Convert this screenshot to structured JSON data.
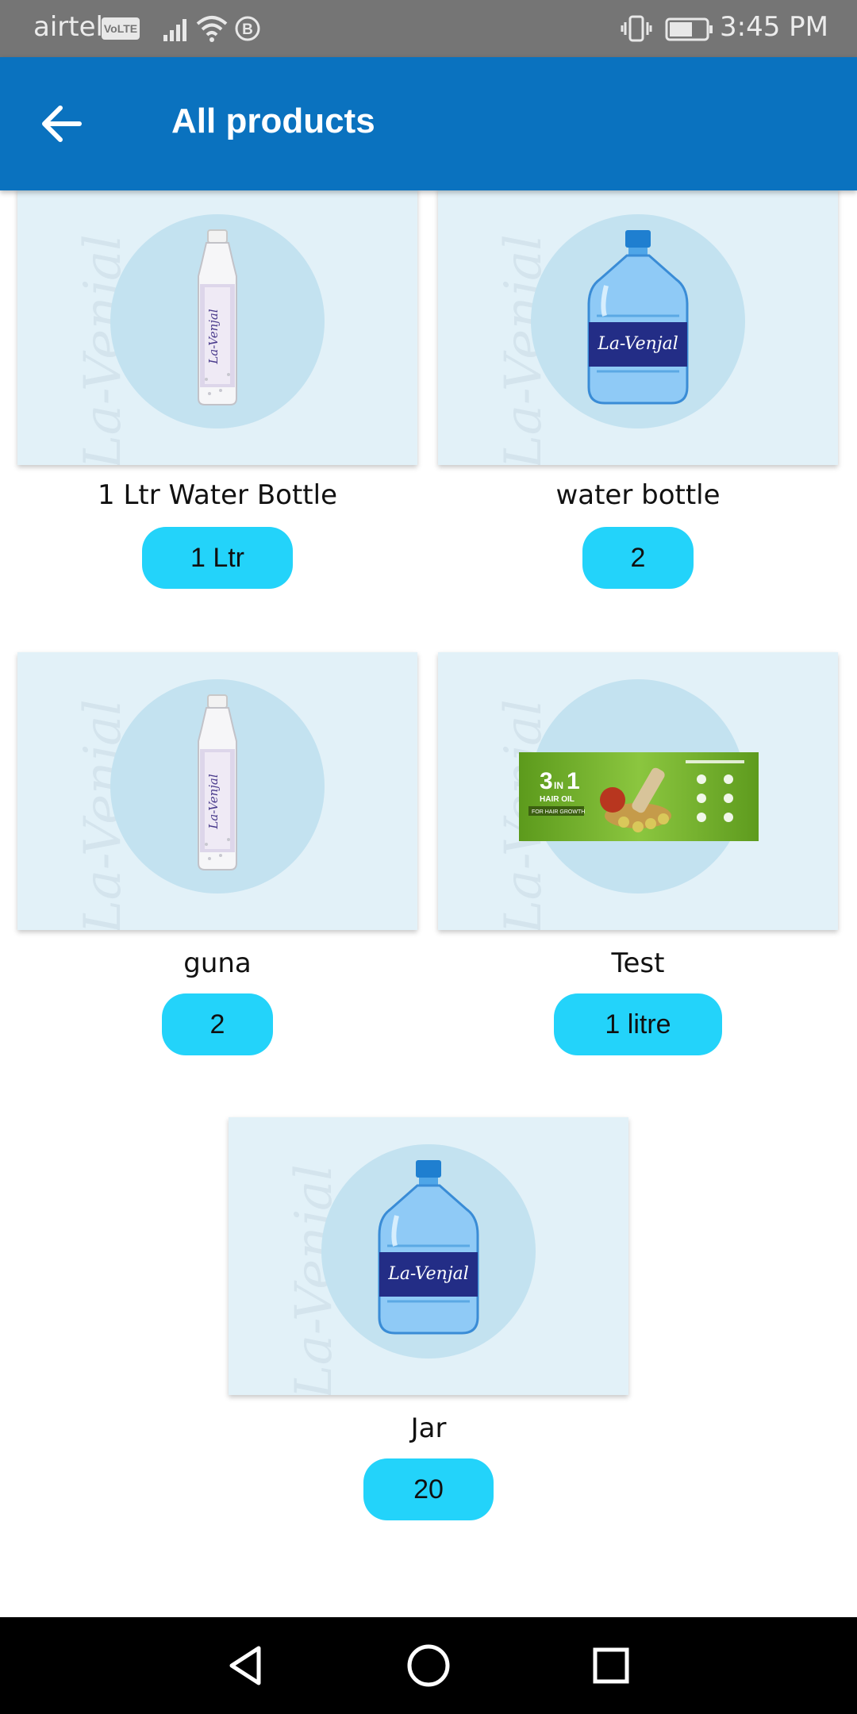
{
  "status_bar": {
    "carrier": "airtel",
    "volte": "VoLTE",
    "time": "3:45 PM",
    "icons": [
      "signal-icon",
      "wifi-icon",
      "b-icon",
      "vibrate-icon",
      "battery-icon"
    ]
  },
  "app_bar": {
    "title": "All products",
    "back_icon": "arrow-left-icon",
    "color": "#0a72bf"
  },
  "products": [
    {
      "name": "1 Ltr Water Bottle",
      "qty": "1 Ltr",
      "image": "small-bottle",
      "watermark": "La-Venjal"
    },
    {
      "name": "water bottle",
      "qty": "2",
      "image": "jar-bottle",
      "watermark": "La-Venjal"
    },
    {
      "name": "guna",
      "qty": "2",
      "image": "small-bottle",
      "watermark": "La-Venjal"
    },
    {
      "name": "Test",
      "qty": "1 litre",
      "image": "hair-oil-banner",
      "watermark": "La-Venjal"
    },
    {
      "name": "Jar",
      "qty": "20",
      "image": "jar-bottle",
      "watermark": "La-Venjal"
    }
  ],
  "banner": {
    "big": "3",
    "small": "IN",
    "one": "1",
    "line1": "HAIR OIL",
    "line2": "FOR HAIR GROWTH"
  },
  "brand_label": "La-Venjal",
  "colors": {
    "qty_pill": "#23d3fa",
    "card_bg": "#e2f1f8",
    "circle": "#c3e2f0"
  },
  "nav_bar": {
    "back_icon": "triangle-back-icon",
    "home_icon": "circle-home-icon",
    "recents_icon": "square-recents-icon"
  }
}
